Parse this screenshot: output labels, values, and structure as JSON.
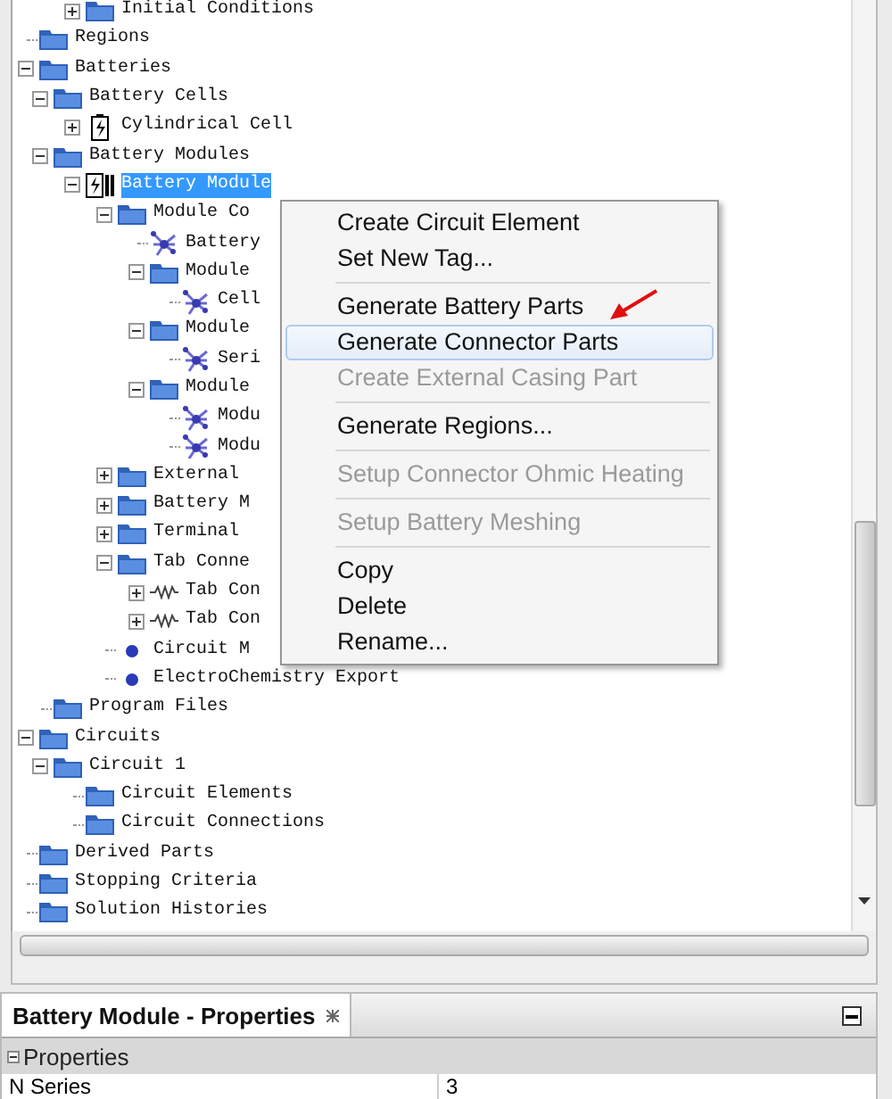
{
  "tree": [
    {
      "children": [
        {
          "children": [
            {
              "label": "Initial Conditions",
              "kind": "folder",
              "expanded": false
            }
          ]
        }
      ]
    },
    {
      "label": "Regions",
      "kind": "folder"
    },
    {
      "label": "Batteries",
      "kind": "folder",
      "expanded": true,
      "children": [
        {
          "label": "Battery Cells",
          "kind": "folder",
          "expanded": true,
          "children": [
            {
              "label": "Cylindrical Cell",
              "kind": "battery",
              "expanded": false
            }
          ]
        },
        {
          "label": "Battery Modules",
          "kind": "folder",
          "expanded": true,
          "children": [
            {
              "label": "Battery Module",
              "kind": "battery-module",
              "expanded": true,
              "selected": true,
              "children": [
                {
                  "label": "Module Co",
                  "kind": "folder",
                  "expanded": true,
                  "children": [
                    {
                      "label": "Battery",
                      "kind": "network"
                    },
                    {
                      "label": "Module",
                      "kind": "folder",
                      "expanded": true,
                      "children": [
                        {
                          "label": "Cell",
                          "kind": "network"
                        }
                      ]
                    },
                    {
                      "label": "Module",
                      "kind": "folder",
                      "expanded": true,
                      "children": [
                        {
                          "label": "Seri",
                          "kind": "network"
                        }
                      ]
                    },
                    {
                      "label": "Module",
                      "kind": "folder",
                      "expanded": true,
                      "children": [
                        {
                          "label": "Modu",
                          "kind": "network"
                        },
                        {
                          "label": "Modu",
                          "kind": "network"
                        }
                      ]
                    }
                  ]
                },
                {
                  "label": "External",
                  "kind": "folder",
                  "expanded": false
                },
                {
                  "label": "Battery M",
                  "kind": "folder",
                  "expanded": false
                },
                {
                  "label": "Terminal",
                  "kind": "folder",
                  "expanded": false
                },
                {
                  "label": "Tab Conne",
                  "kind": "folder",
                  "expanded": true,
                  "children": [
                    {
                      "label": "Tab Con",
                      "kind": "resistor",
                      "expanded": false
                    },
                    {
                      "label": "Tab Con",
                      "kind": "resistor",
                      "expanded": false
                    }
                  ]
                },
                {
                  "label": "Circuit M",
                  "kind": "dot"
                },
                {
                  "label": "ElectroChemistry Export",
                  "kind": "dot"
                }
              ]
            }
          ]
        },
        {
          "label": "Program Files",
          "kind": "folder"
        }
      ]
    },
    {
      "label": "Circuits",
      "kind": "folder",
      "expanded": true,
      "children": [
        {
          "label": "Circuit 1",
          "kind": "folder",
          "expanded": true,
          "children": [
            {
              "label": "Circuit Elements",
              "kind": "folder"
            },
            {
              "label": "Circuit Connections",
              "kind": "folder"
            }
          ]
        }
      ]
    },
    {
      "label": "Derived Parts",
      "kind": "folder"
    },
    {
      "label": "Stopping Criteria",
      "kind": "folder"
    },
    {
      "label": "Solution Histories",
      "kind": "folder"
    }
  ],
  "context_menu": [
    {
      "kind": "item",
      "label": "Create Circuit Element",
      "disabled": false,
      "selected": false
    },
    {
      "kind": "item",
      "label": "Set New Tag...",
      "disabled": false,
      "selected": false
    },
    {
      "kind": "separator"
    },
    {
      "kind": "item",
      "label": "Generate Battery Parts",
      "disabled": false,
      "selected": false
    },
    {
      "kind": "item",
      "label": "Generate Connector Parts",
      "disabled": false,
      "selected": true
    },
    {
      "kind": "item",
      "label": "Create External Casing Part",
      "disabled": true,
      "selected": false
    },
    {
      "kind": "separator"
    },
    {
      "kind": "item",
      "label": "Generate Regions...",
      "disabled": false,
      "selected": false
    },
    {
      "kind": "separator"
    },
    {
      "kind": "item",
      "label": "Setup Connector Ohmic Heating",
      "disabled": true,
      "selected": false
    },
    {
      "kind": "separator"
    },
    {
      "kind": "item",
      "label": "Setup Battery Meshing",
      "disabled": true,
      "selected": false
    },
    {
      "kind": "separator"
    },
    {
      "kind": "item",
      "label": "Copy",
      "disabled": false,
      "selected": false
    },
    {
      "kind": "item",
      "label": "Delete",
      "disabled": false,
      "selected": false
    },
    {
      "kind": "item",
      "label": "Rename...",
      "disabled": false,
      "selected": false
    }
  ],
  "properties_panel": {
    "title": "Battery Module - Properties",
    "section": {
      "label": "Properties",
      "expanded": true
    },
    "rows": [
      {
        "name": "N Series",
        "value": "3"
      }
    ]
  }
}
